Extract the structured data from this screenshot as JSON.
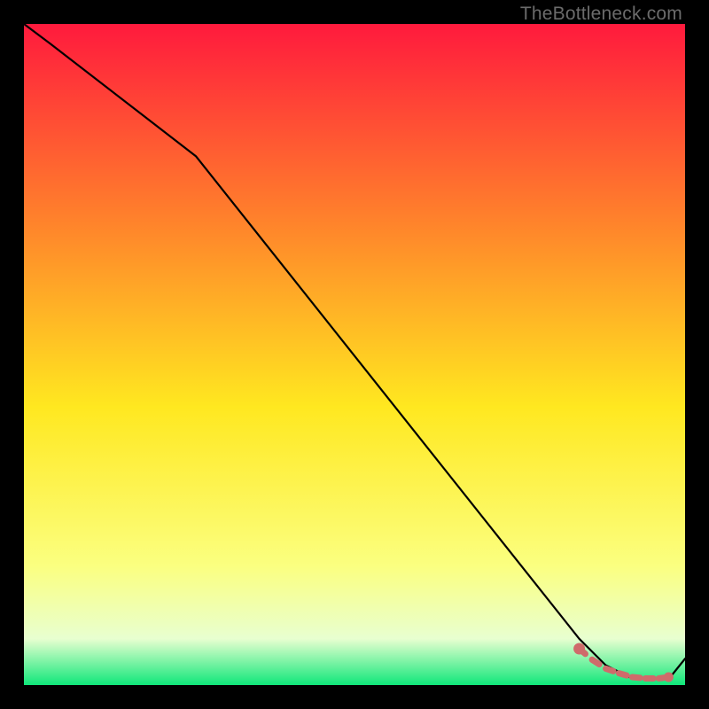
{
  "watermark": "TheBottleneck.com",
  "chart_data": {
    "type": "line",
    "title": "",
    "xlabel": "",
    "ylabel": "",
    "xlim": [
      0,
      100
    ],
    "ylim": [
      0,
      100
    ],
    "grid": false,
    "legend": false,
    "background_gradient": {
      "top_color": "#ff1a3d",
      "mid_upper_color": "#ff8a2a",
      "mid_color": "#ffe820",
      "mid_lower_color": "#fbff80",
      "near_bottom_color": "#e8ffd0",
      "bottom_color": "#10e77a"
    },
    "series": [
      {
        "name": "bottleneck-curve",
        "color": "#000000",
        "x": [
          0,
          4,
          26,
          84,
          88,
          92,
          96,
          98,
          100
        ],
        "y": [
          100,
          97,
          80,
          7,
          3,
          1,
          1,
          1.5,
          4
        ]
      },
      {
        "name": "optimal-marker",
        "type": "marker-dashed",
        "color": "#cf6b6b",
        "x": [
          84,
          86,
          88,
          90,
          92,
          94,
          96,
          97.5
        ],
        "y": [
          5.5,
          3.8,
          2.5,
          1.8,
          1.2,
          1.0,
          1.0,
          1.2
        ]
      }
    ]
  }
}
